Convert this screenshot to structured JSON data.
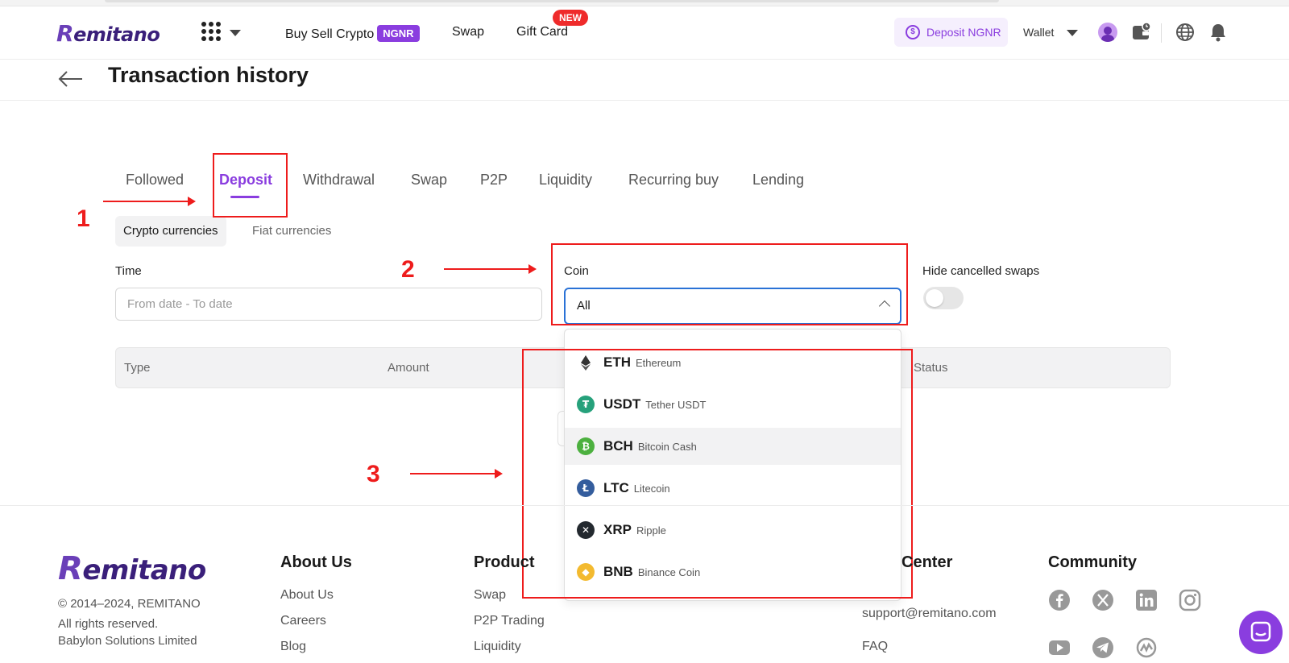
{
  "header": {
    "logo_text": "Remitano",
    "nav": {
      "buy_sell": "Buy Sell Crypto",
      "buy_sell_badge": "NGNR",
      "swap": "Swap",
      "gift_card": "Gift Card",
      "gift_card_badge": "NEW"
    },
    "deposit_button": "Deposit NGNR",
    "wallet": "Wallet"
  },
  "page": {
    "title": "Transaction history"
  },
  "tabs": [
    {
      "label": "Followed"
    },
    {
      "label": "Deposit",
      "active": true
    },
    {
      "label": "Withdrawal"
    },
    {
      "label": "Swap"
    },
    {
      "label": "P2P"
    },
    {
      "label": "Liquidity"
    },
    {
      "label": "Recurring buy"
    },
    {
      "label": "Lending"
    }
  ],
  "subtabs": {
    "crypto": "Crypto currencies",
    "fiat": "Fiat currencies"
  },
  "filters": {
    "time_label": "Time",
    "date_placeholder": "From date - To date",
    "coin_label": "Coin",
    "coin_value": "All",
    "hide_cancelled_label": "Hide cancelled swaps",
    "hide_cancelled_on": false
  },
  "table": {
    "headers": [
      "Type",
      "Amount",
      "Status"
    ]
  },
  "coin_options": [
    {
      "symbol": "ETH",
      "name": "Ethereum",
      "color": "#ffffff",
      "icon": "ethereum-icon"
    },
    {
      "symbol": "USDT",
      "name": "Tether USDT",
      "color": "#26a17b",
      "icon": "tether-icon"
    },
    {
      "symbol": "BCH",
      "name": "Bitcoin Cash",
      "color": "#4cb03f",
      "icon": "bitcoin-cash-icon"
    },
    {
      "symbol": "LTC",
      "name": "Litecoin",
      "color": "#345d9d",
      "icon": "litecoin-icon"
    },
    {
      "symbol": "XRP",
      "name": "Ripple",
      "color": "#23292f",
      "icon": "ripple-icon"
    },
    {
      "symbol": "BNB",
      "name": "Binance Coin",
      "color": "#f3ba2f",
      "icon": "binance-icon"
    }
  ],
  "annotations": {
    "step1": "1",
    "step2": "2",
    "step3": "3",
    "color": "#ee1c1c"
  },
  "footer": {
    "logo_text": "Remitano",
    "copyright": "© 2014–2024, REMITANO",
    "rights": "All rights reserved.",
    "company": "Babylon Solutions Limited",
    "about_heading": "About Us",
    "about_links": [
      "About Us",
      "Careers",
      "Blog"
    ],
    "product_heading": "Product",
    "product_links": [
      "Swap",
      "P2P Trading",
      "Liquidity"
    ],
    "help_heading_visible": "Center",
    "help_links": [
      "support@remitano.com",
      "FAQ"
    ],
    "community_heading": "Community"
  },
  "colors": {
    "brand": "#8a3ddf",
    "brand_dark": "#3a1f7a",
    "focus_border": "#2a72d6"
  }
}
